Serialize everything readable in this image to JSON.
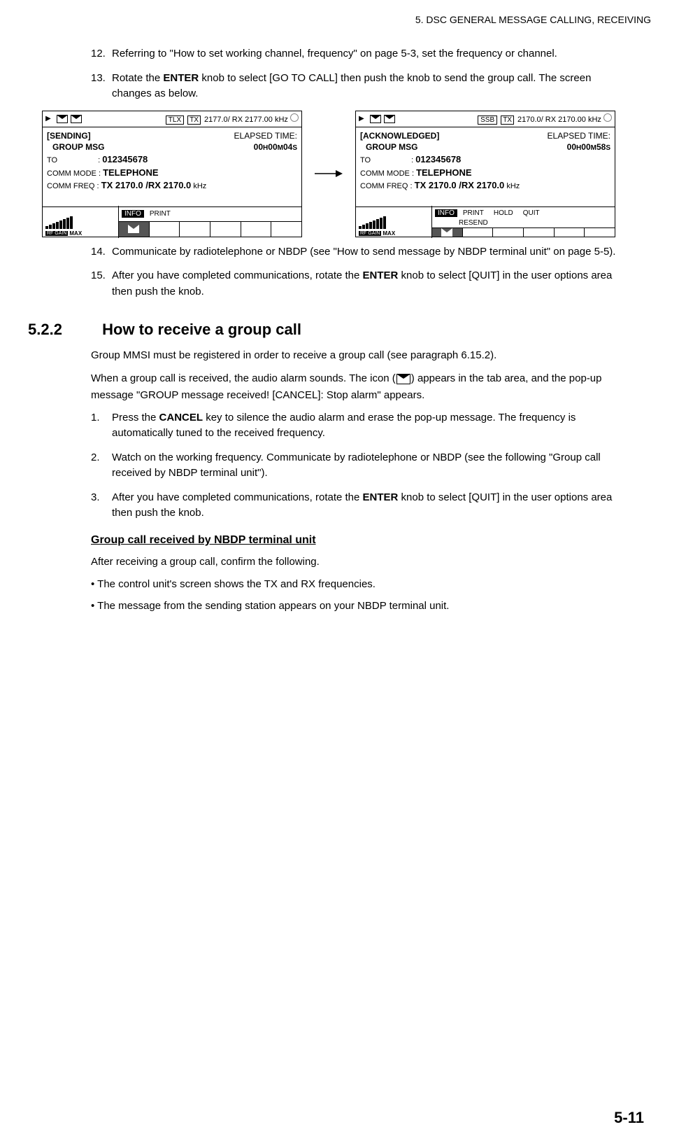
{
  "header": "5.  DSC GENERAL MESSAGE CALLING, RECEIVING",
  "steps_a": [
    {
      "num": "12.",
      "text": "Referring to \"How to set working channel, frequency\" on page 5-3, set the frequency or channel."
    },
    {
      "num": "13.",
      "text_pre": "Rotate the ",
      "bold": "ENTER",
      "text_post": " knob to select [GO TO CALL] then push the knob to send the group call. The screen changes as below."
    }
  ],
  "screen1": {
    "mode": "TLX",
    "tx": "TX",
    "freq_tx": "2177.0",
    "rx_label": "/ RX",
    "freq_rx": "2177.00",
    "unit": "kHz",
    "status": "[SENDING]",
    "elapsed_label": "ELAPSED TIME:",
    "msg_type": "GROUP  MSG",
    "elapsed_h": "00",
    "elapsed_m": "00",
    "elapsed_s": "04",
    "to_label": "TO",
    "to_val": "012345678",
    "comm_mode_label": "COMM MODE :",
    "comm_mode_val": "TELEPHONE",
    "comm_freq_label": "COMM FREQ  :",
    "comm_freq_val": "TX   2170.0 /RX    2170.0",
    "comm_freq_unit": "kHz",
    "info": "INFO",
    "opts": [
      "PRINT"
    ],
    "rfgain": "RF GAIN",
    "max": "MAX"
  },
  "screen2": {
    "mode": "SSB",
    "tx": "TX",
    "freq_tx": "2170.0",
    "rx_label": "/ RX",
    "freq_rx": "2170.00",
    "unit": "kHz",
    "status": "[ACKNOWLEDGED]",
    "elapsed_label": "ELAPSED TIME:",
    "msg_type": "GROUP  MSG",
    "elapsed_h": "00",
    "elapsed_m": "00",
    "elapsed_s": "58",
    "to_label": "TO",
    "to_val": "012345678",
    "comm_mode_label": "COMM MODE :",
    "comm_mode_val": "TELEPHONE",
    "comm_freq_label": "COMM FREQ  :",
    "comm_freq_val": "TX   2170.0 /RX    2170.0",
    "comm_freq_unit": "kHz",
    "info": "INFO",
    "opts": [
      "PRINT",
      "HOLD",
      "QUIT"
    ],
    "resend": "RESEND",
    "rfgain": "RF GAIN",
    "max": "MAX"
  },
  "steps_b": [
    {
      "num": "14.",
      "text": "Communicate by radiotelephone or NBDP (see \"How to send message by NBDP terminal unit\" on page 5-5)."
    },
    {
      "num": "15.",
      "text_pre": "After you have completed communications, rotate the ",
      "bold": "ENTER",
      "text_post": " knob to select [QUIT] in the user options area then push the knob."
    }
  ],
  "section": {
    "num": "5.2.2",
    "title": "How to receive a group call"
  },
  "para1": "Group MMSI must be registered in order to receive a group call (see paragraph 6.15.2).",
  "para2_pre": "When a group call is received, the audio alarm sounds. The icon (",
  "para2_post": ") appears in the tab area, and the pop-up message \"GROUP message received! [CANCEL]: Stop alarm\" appears.",
  "steps_c": [
    {
      "num": "1.",
      "text_pre": "Press the ",
      "bold": "CANCEL",
      "text_post": " key to silence the audio alarm and erase the pop-up message. The frequency is automatically tuned to the received frequency."
    },
    {
      "num": "2.",
      "text": "Watch on the working frequency. Communicate by radiotelephone or NBDP (see the following \"Group call received by NBDP terminal unit\")."
    },
    {
      "num": "3.",
      "text_pre": "After you have completed communications, rotate the ",
      "bold": "ENTER",
      "text_post": " knob to select [QUIT] in the user options area then push the knob."
    }
  ],
  "subhead": "Group call received by NBDP terminal unit",
  "para3": "After receiving a group call, confirm the following.",
  "bullets": [
    "The control unit's screen shows the TX and RX frequencies.",
    "The message from the sending station appears on your NBDP terminal unit."
  ],
  "page_num": "5-11",
  "h_unit": "H",
  "m_unit": "M",
  "s_unit": "S"
}
